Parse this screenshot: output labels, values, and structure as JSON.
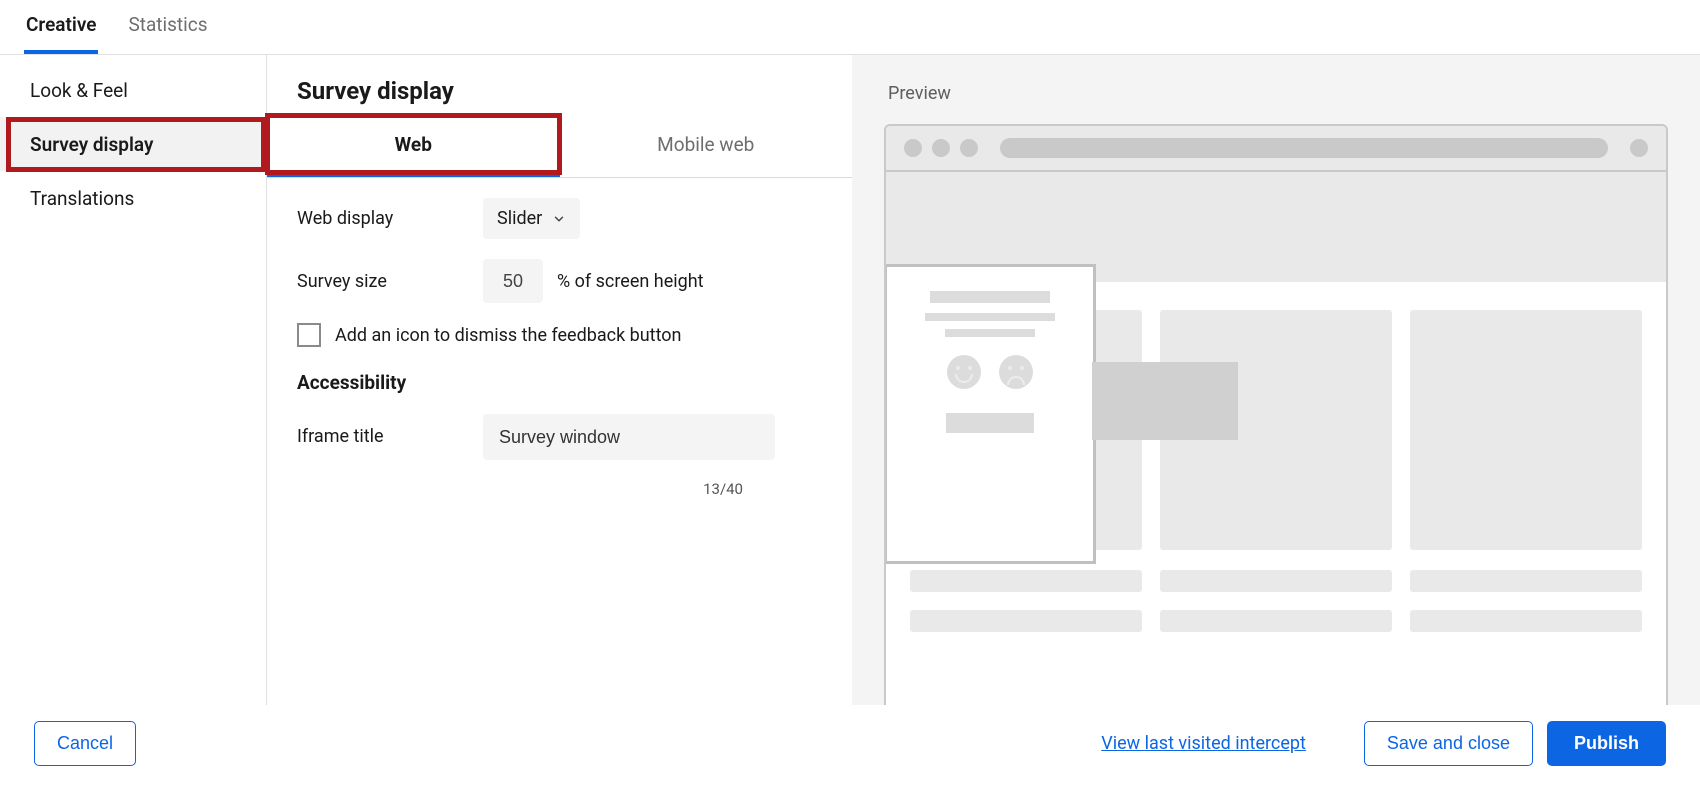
{
  "top_tabs": {
    "creative": "Creative",
    "statistics": "Statistics"
  },
  "sidebar": {
    "items": [
      "Look & Feel",
      "Survey display",
      "Translations"
    ],
    "active": 1
  },
  "page": {
    "title": "Survey display",
    "mtabs": {
      "web": "Web",
      "mobile": "Mobile web"
    },
    "web_display": {
      "label": "Web display",
      "value": "Slider"
    },
    "survey_size": {
      "label": "Survey size",
      "value": "50",
      "suffix": "% of screen height"
    },
    "dismiss_check": {
      "label": "Add an icon to dismiss the feedback button",
      "checked": false
    },
    "accessibility_heading": "Accessibility",
    "iframe_title": {
      "label": "Iframe title",
      "value": "Survey window",
      "counter": "13/40"
    }
  },
  "preview": {
    "label": "Preview"
  },
  "footer": {
    "cancel": "Cancel",
    "view_link": "View last visited intercept",
    "save": "Save and close",
    "publish": "Publish"
  }
}
